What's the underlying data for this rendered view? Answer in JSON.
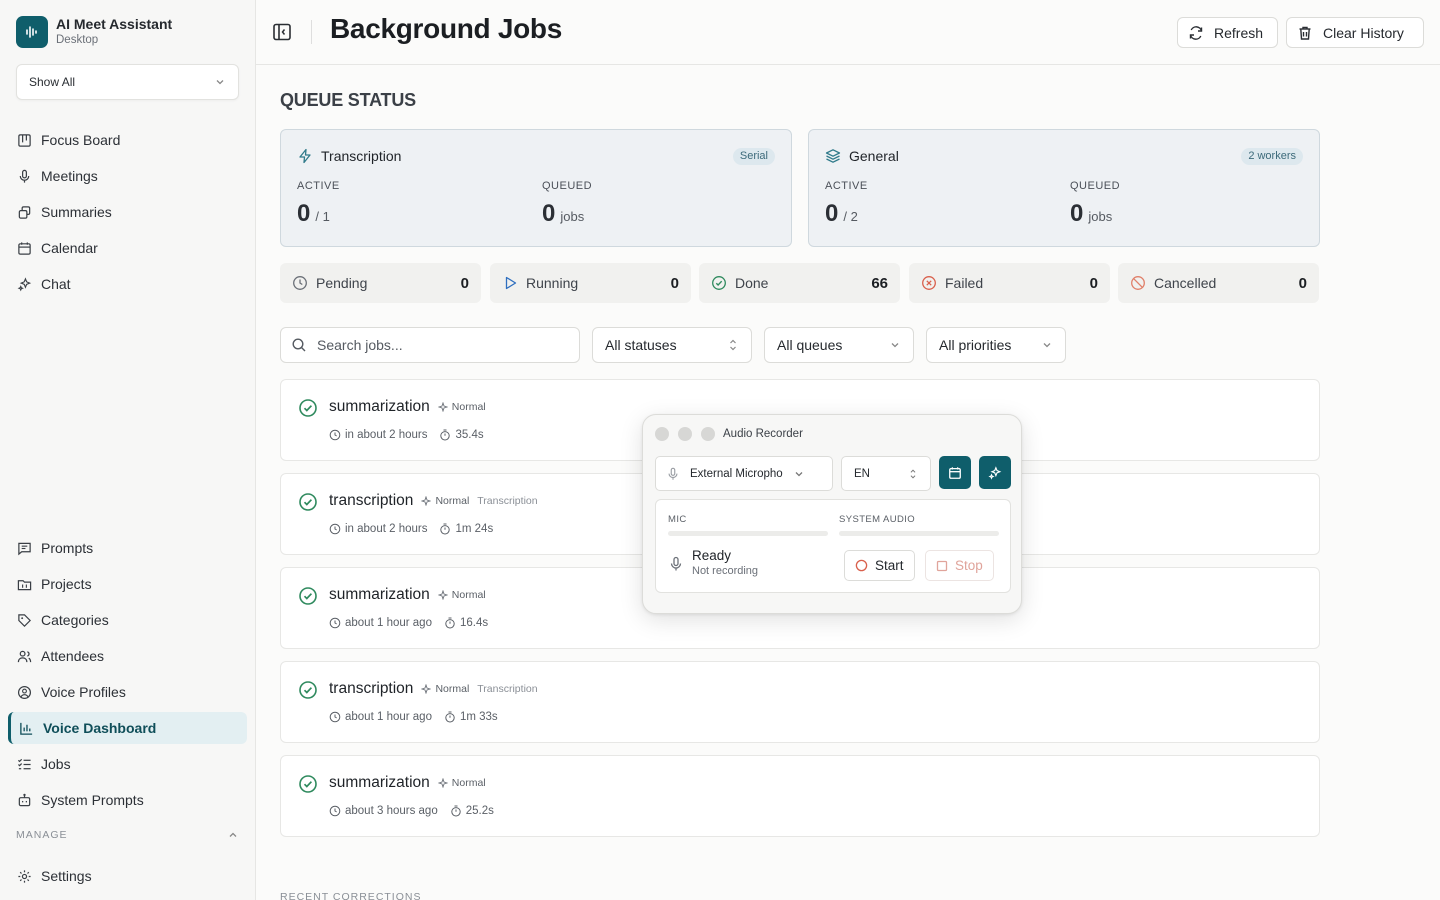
{
  "brand": {
    "name": "AI Meet Assistant",
    "subtitle": "Desktop"
  },
  "sidebar": {
    "filter_select": "Show All",
    "top_items": [
      {
        "label": "Focus Board",
        "icon": "board-icon"
      },
      {
        "label": "Meetings",
        "icon": "microphone-icon"
      },
      {
        "label": "Summaries",
        "icon": "copy-icon"
      },
      {
        "label": "Calendar",
        "icon": "calendar-icon"
      },
      {
        "label": "Chat",
        "icon": "sparkles-icon"
      }
    ],
    "bottom_items": [
      {
        "label": "Prompts",
        "icon": "message-icon"
      },
      {
        "label": "Projects",
        "icon": "folder-icon"
      },
      {
        "label": "Categories",
        "icon": "tag-icon"
      },
      {
        "label": "Attendees",
        "icon": "users-icon"
      },
      {
        "label": "Voice Profiles",
        "icon": "user-circle-icon"
      },
      {
        "label": "Voice Dashboard",
        "icon": "bar-chart-icon",
        "active": true
      },
      {
        "label": "Jobs",
        "icon": "list-checks-icon"
      },
      {
        "label": "System Prompts",
        "icon": "bot-icon"
      }
    ],
    "manage_label": "MANAGE",
    "settings_label": "Settings"
  },
  "header": {
    "title": "Background Jobs",
    "refresh_label": "Refresh",
    "clear_label": "Clear History"
  },
  "queue": {
    "section_title": "QUEUE STATUS",
    "cards": [
      {
        "name": "Transcription",
        "badge": "Serial",
        "active_label": "ACTIVE",
        "active_value": "0",
        "active_max": "/ 1",
        "queued_label": "QUEUED",
        "queued_value": "0",
        "queued_unit": "jobs"
      },
      {
        "name": "General",
        "badge": "2 workers",
        "active_label": "ACTIVE",
        "active_value": "0",
        "active_max": "/ 2",
        "queued_label": "QUEUED",
        "queued_value": "0",
        "queued_unit": "jobs"
      }
    ]
  },
  "stats": [
    {
      "label": "Pending",
      "value": "0"
    },
    {
      "label": "Running",
      "value": "0"
    },
    {
      "label": "Done",
      "value": "66"
    },
    {
      "label": "Failed",
      "value": "0"
    },
    {
      "label": "Cancelled",
      "value": "0"
    }
  ],
  "filters": {
    "search_placeholder": "Search jobs...",
    "status": "All statuses",
    "queue": "All queues",
    "priority": "All priorities"
  },
  "jobs": [
    {
      "name": "summarization",
      "priority": "Normal",
      "queue": "",
      "time": "in about 2 hours",
      "duration": "35.4s"
    },
    {
      "name": "transcription",
      "priority": "Normal",
      "queue": "Transcription",
      "time": "in about 2 hours",
      "duration": "1m 24s"
    },
    {
      "name": "summarization",
      "priority": "Normal",
      "queue": "",
      "time": "about 1 hour ago",
      "duration": "16.4s"
    },
    {
      "name": "transcription",
      "priority": "Normal",
      "queue": "Transcription",
      "time": "about 1 hour ago",
      "duration": "1m 33s"
    },
    {
      "name": "summarization",
      "priority": "Normal",
      "queue": "",
      "time": "about 3 hours ago",
      "duration": "25.2s"
    }
  ],
  "recent_label": "RECENT CORRECTIONS",
  "recorder": {
    "title": "Audio Recorder",
    "mic_device": "External Micropho",
    "language": "EN",
    "mic_label": "MIC",
    "system_label": "SYSTEM AUDIO",
    "mic_level": 0,
    "system_level": 0,
    "status": "Ready",
    "substatus": "Not recording",
    "start_label": "Start",
    "stop_label": "Stop"
  },
  "colors": {
    "accent": "#0f5e6b",
    "success": "#2f8a5e",
    "danger": "#d9604c"
  }
}
